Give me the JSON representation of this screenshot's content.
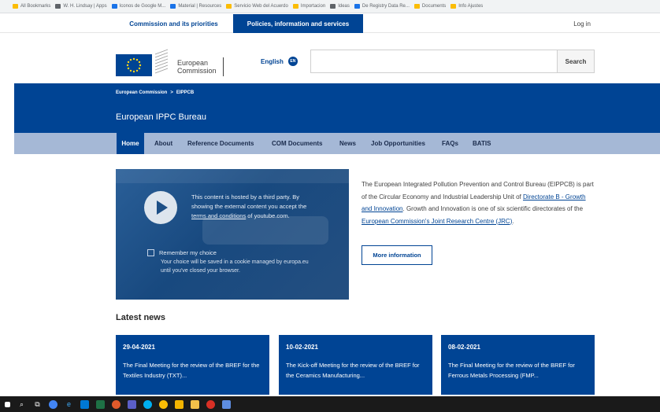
{
  "bookmarks": [
    {
      "label": "All Bookmarks",
      "color": "#fbbc04"
    },
    {
      "label": "W. H. Lindsay | Apps",
      "color": "#5f6368"
    },
    {
      "label": "Iconos de Google M...",
      "color": "#1a73e8"
    },
    {
      "label": "Material | Resources",
      "color": "#1a73e8"
    },
    {
      "label": "Servicio Web del Acuerdo",
      "color": "#fbbc04"
    },
    {
      "label": "Importacion",
      "color": "#fbbc04"
    },
    {
      "label": "Ideas",
      "color": "#5f6368"
    },
    {
      "label": "De Registry Data Re...",
      "color": "#1a73e8"
    },
    {
      "label": "Documents",
      "color": "#fbbc04"
    },
    {
      "label": "Info Ajustes",
      "color": "#fbbc04"
    }
  ],
  "topnav": {
    "commission": "Commission and its priorities",
    "policies": "Policies, information and services",
    "login": "Log in"
  },
  "header": {
    "logo_line1": "European",
    "logo_line2": "Commission",
    "language": "English",
    "language_code": "EN",
    "search_placeholder": "",
    "search_button": "Search"
  },
  "band": {
    "breadcrumb": [
      "European Commission",
      ">",
      "EIPPCB"
    ],
    "title": "European IPPC Bureau"
  },
  "sitenav": {
    "items": [
      "Home",
      "About",
      "Reference Documents",
      "COM Documents",
      "News",
      "Job Opportunities",
      "FAQs",
      "BATIS"
    ]
  },
  "video": {
    "text_before": "This content is hosted by a third party. By showing the external content you accept the",
    "terms_link": "terms and conditions",
    "text_after": "of youtube.com.",
    "remember": "Remember my choice",
    "remember_note": "Your choice will be saved in a cookie managed by europa.eu until you've closed your browser."
  },
  "intro": {
    "part1": "The European Integrated Pollution Prevention and Control Bureau (EIPPCB) is part of the Circular Economy and Industrial Leadership Unit of",
    "link1": "Directorate B - Growth and Innovation",
    "part2": ". Growth and Innovation is one of six scientific directorates of the",
    "link2": "European Commission's Joint Research Centre (JRC)",
    "part3": ".",
    "more_button": "More information"
  },
  "news": {
    "heading": "Latest news",
    "items": [
      {
        "date": "29-04-2021",
        "title": "The Final Meeting for the review of the BREF for the Textiles Industry (TXT)..."
      },
      {
        "date": "10-02-2021",
        "title": "The Kick-off Meeting for the review of the BREF for the Ceramics Manufacturing..."
      },
      {
        "date": "08-02-2021",
        "title": "The Final Meeting for the review of the BREF for Ferrous Metals Processing (FMP..."
      }
    ]
  },
  "colors": {
    "ec_blue": "#004494",
    "nav_light": "#a5b8d6"
  }
}
